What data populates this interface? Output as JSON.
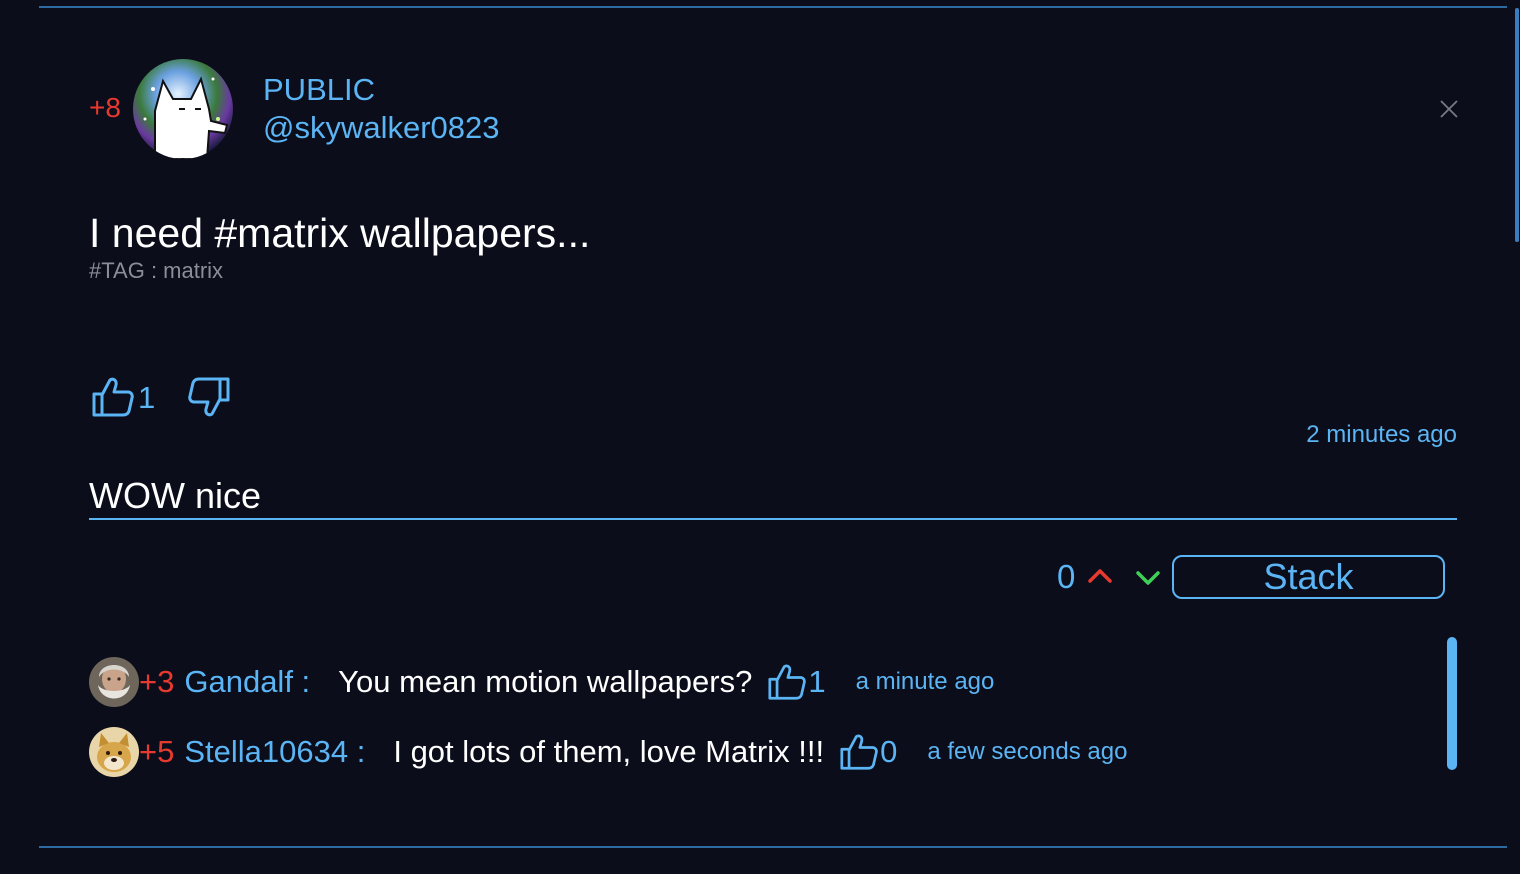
{
  "post": {
    "score": "+8",
    "visibility": "PUBLIC",
    "username": "@skywalker0823",
    "text": "I need #matrix wallpapers...",
    "tag": "#TAG : matrix",
    "like_count": "1",
    "time": "2 minutes ago",
    "avatar_icon": "husky-avatar"
  },
  "comment_form": {
    "input_value": "WOW nice",
    "vote_count": "0",
    "stack_label": "Stack"
  },
  "comments": [
    {
      "score": "+3",
      "name": "Gandalf :",
      "text": "You mean motion wallpapers?",
      "likes": "1",
      "time": "a minute ago",
      "avatar_icon": "wizard-avatar"
    },
    {
      "score": "+5",
      "name": "Stella10634 :",
      "text": "I got lots of them, love Matrix !!!",
      "likes": "0",
      "time": "a few seconds ago",
      "avatar_icon": "doge-avatar"
    }
  ],
  "colors": {
    "background": "#0b0d1a",
    "accent_blue": "#5bb4f4",
    "score_red": "#e8392f",
    "vote_down_green": "#3ecf56",
    "tag_gray": "#8d8d97"
  }
}
